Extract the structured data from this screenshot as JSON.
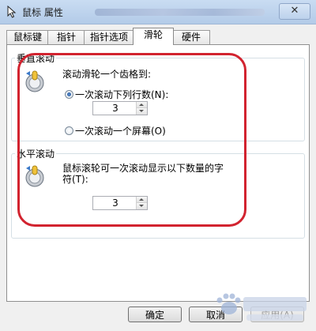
{
  "window": {
    "title": "鼠标 属性",
    "close_glyph": "✕"
  },
  "tabs": [
    {
      "label": "鼠标键",
      "active": false
    },
    {
      "label": "指针",
      "active": false
    },
    {
      "label": "指针选项",
      "active": false
    },
    {
      "label": "滑轮",
      "active": true
    },
    {
      "label": "硬件",
      "active": false
    }
  ],
  "vertical": {
    "title": "垂直滚动",
    "description": "滚动滑轮一个齿格到:",
    "option_lines": "一次滚动下列行数(N):",
    "lines_value": "3",
    "option_screen": "一次滚动一个屏幕(O)",
    "selected": "lines"
  },
  "horizontal": {
    "title": "水平滚动",
    "description_line1": "鼠标滚轮可一次滚动显示以下数量的字",
    "description_line2": "符(T):",
    "chars_value": "3"
  },
  "buttons": {
    "ok": "确定",
    "cancel": "取消",
    "apply": "应用(A)"
  },
  "colors": {
    "highlight": "#d2232f",
    "radio_fill": "#1f4f92"
  },
  "icons": {
    "window": "mouse-pointer-icon",
    "wheel": "mouse-wheel-icon"
  }
}
